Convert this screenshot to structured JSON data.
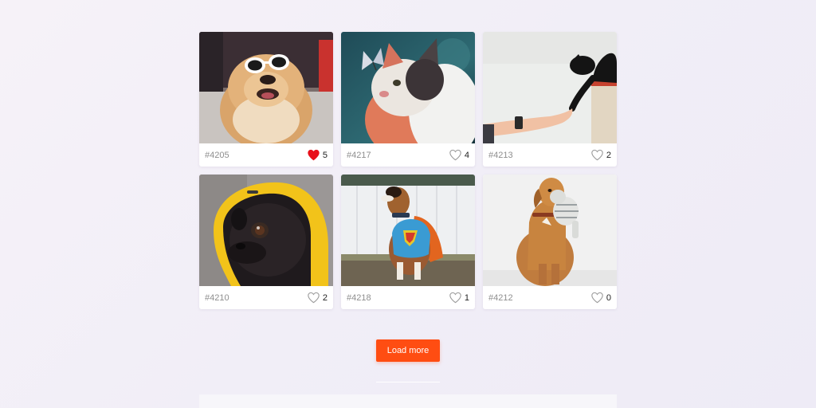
{
  "gallery": {
    "items": [
      {
        "tag": "#4205",
        "likes": "5",
        "liked": true
      },
      {
        "tag": "#4217",
        "likes": "4",
        "liked": false
      },
      {
        "tag": "#4213",
        "likes": "2",
        "liked": false
      },
      {
        "tag": "#4210",
        "likes": "2",
        "liked": false
      },
      {
        "tag": "#4218",
        "likes": "1",
        "liked": false
      },
      {
        "tag": "#4212",
        "likes": "0",
        "liked": false
      }
    ]
  },
  "actions": {
    "load_more_label": "Load more"
  },
  "colors": {
    "accent": "#ff4d12",
    "heart_liked": "#e8101a",
    "heart_outline": "#9a9a9a"
  }
}
